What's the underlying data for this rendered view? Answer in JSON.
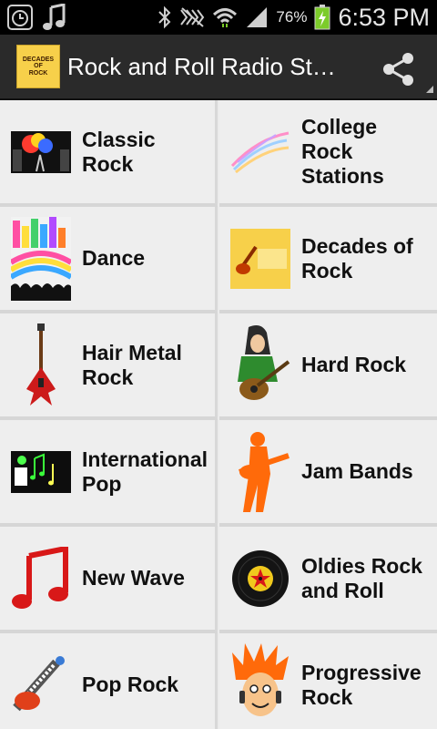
{
  "status_bar": {
    "battery_percent": "76%",
    "time": "6:53 PM"
  },
  "action_bar": {
    "title": "Rock and Roll Radio St…",
    "logo_text": [
      "DECADES",
      "OF",
      "ROCK"
    ]
  },
  "stations": [
    {
      "label": "Classic Rock",
      "icon": "stage-concert-image"
    },
    {
      "label": "College Rock Stations",
      "icon": "pastel-swirl-image"
    },
    {
      "label": "Dance",
      "icon": "dance-party-image"
    },
    {
      "label": "Decades of Rock",
      "icon": "decades-of-rock-logo"
    },
    {
      "label": "Hair Metal Rock",
      "icon": "red-electric-guitar-image"
    },
    {
      "label": "Hard Rock",
      "icon": "rocker-guitarist-image"
    },
    {
      "label": "International Pop",
      "icon": "music-notes-image"
    },
    {
      "label": "Jam Bands",
      "icon": "guitarist-silhouette-image"
    },
    {
      "label": "New Wave",
      "icon": "red-music-note-image"
    },
    {
      "label": "Oldies Rock and Roll",
      "icon": "vinyl-record-image"
    },
    {
      "label": "Pop Rock",
      "icon": "keytar-image"
    },
    {
      "label": "Progressive Rock",
      "icon": "orange-hair-character-image"
    }
  ]
}
